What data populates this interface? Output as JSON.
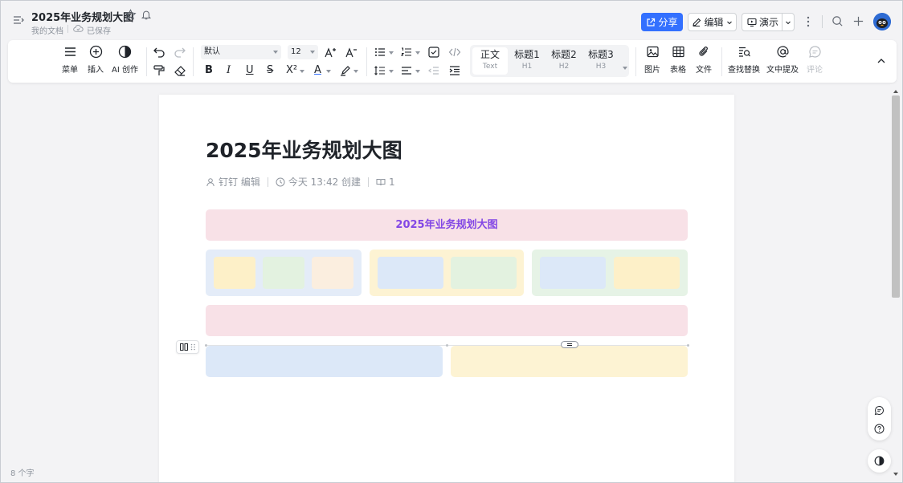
{
  "header": {
    "doc_title": "2025年业务规划大图",
    "path": "我的文档",
    "save_status": "已保存",
    "share_label": "分享",
    "edit_label": "编辑",
    "present_label": "演示"
  },
  "toolbar": {
    "menu_label": "菜单",
    "insert_label": "插入",
    "ai_label": "AI 创作",
    "font_value": "默认",
    "size_value": "12",
    "bold": "B",
    "italic": "I",
    "underline": "U",
    "strike": "S",
    "superscript": "X²",
    "font_color": "A",
    "headings": [
      {
        "label": "正文",
        "sub": "Text"
      },
      {
        "label": "标题1",
        "sub": "H1"
      },
      {
        "label": "标题2",
        "sub": "H2"
      },
      {
        "label": "标题3",
        "sub": "H3"
      }
    ],
    "image_label": "图片",
    "table_label": "表格",
    "file_label": "文件",
    "find_replace_label": "查找替换",
    "mention_label": "文中提及",
    "comment_label": "评论"
  },
  "document": {
    "title": "2025年业务规划大图",
    "author": "钉钉 编辑",
    "created": "今天 13:42 创建",
    "reads": "1",
    "diagram_banner": "2025年业务规划大图"
  },
  "footer": {
    "word_count": "8 个字"
  },
  "colors": {
    "accent": "#3370ff",
    "banner_text": "#8347e5",
    "pink": "#f8e1e7",
    "blue": "#dce8f8",
    "yellow": "#fdf3d3",
    "green": "#e6f3e6"
  }
}
